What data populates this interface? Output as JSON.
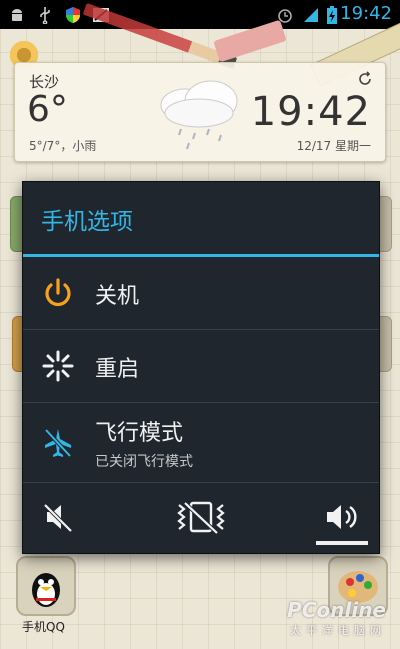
{
  "status_bar": {
    "time": "19:42",
    "icons": [
      "android-debug-icon",
      "usb-icon",
      "shield-icon",
      "screenshot-icon",
      "alarm-icon",
      "signal-icon",
      "battery-charging-icon"
    ],
    "accent_color": "#33b5e5"
  },
  "weather_widget": {
    "city": "长沙",
    "temperature": "6°",
    "range_condition": "5°/7°，小雨",
    "time": "19:42",
    "date": "12/17 星期一",
    "condition_icon": "rain-cloud-icon"
  },
  "dialog": {
    "title": "手机选项",
    "items": [
      {
        "label": "关机",
        "icon": "power-icon"
      },
      {
        "label": "重启",
        "icon": "restart-icon"
      },
      {
        "label": "飞行模式",
        "sublabel": "已关闭飞行模式",
        "icon": "airplane-off-icon"
      }
    ],
    "sound_modes": [
      {
        "icon": "mute-icon",
        "selected": false
      },
      {
        "icon": "vibrate-icon",
        "selected": false
      },
      {
        "icon": "volume-icon",
        "selected": true
      }
    ],
    "accent_color": "#33b5e5"
  },
  "dock": {
    "qq_label": "手机QQ"
  },
  "watermark": {
    "brand": "PConline",
    "sub": "太平洋电脑网"
  }
}
